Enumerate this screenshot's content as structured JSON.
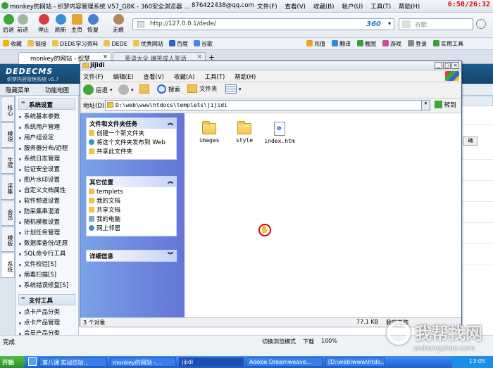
{
  "browser": {
    "window_title": "monkey的网站 - 织梦内容管理系统 V57_GBK - 360安全浏览器 ...",
    "account": "876422438@qq.com",
    "menus": [
      "文件(F)",
      "查看(V)",
      "收藏(B)",
      "帐户(U)",
      "工具(T)",
      "帮助(H)"
    ],
    "clock": "6:50/26:32",
    "nav": {
      "back": "后退",
      "forward": "前进",
      "stop": "停止",
      "refresh": "刷新",
      "home": "主页",
      "restore": "恢复",
      "no_image": "无痕"
    },
    "address": "http://127.0.0.1/dede/",
    "engine_badge": "360",
    "search_placeholder": "谷歌",
    "favorites": [
      "收藏",
      "链接",
      "DEDE学习资料",
      "DEDE",
      "优秀网站",
      "百度",
      "谷歌"
    ],
    "fav_right": [
      "充值",
      "翻译",
      "截图",
      "游戏",
      "登录",
      "实用工具"
    ],
    "tabs": [
      {
        "label": "monkey的网站 - 织梦",
        "active": true
      },
      {
        "label": "英语大全 爆笑成人笑话",
        "active": false
      }
    ],
    "status_text": "完成",
    "status_right": [
      "切换浏览模式",
      "下载",
      "100%"
    ]
  },
  "dede": {
    "brand": "DEDECMS",
    "brand_sub": "织梦内容管理系统 v5.7",
    "subnav": [
      "隐藏菜单",
      "功能地图"
    ],
    "vertical_tabs": [
      "核心",
      "模块",
      "生成",
      "采集",
      "会员",
      "模板",
      "系统"
    ],
    "sections": [
      {
        "title": "系统设置",
        "items": [
          "系统基本参数",
          "系统用户管理",
          "用户组设定",
          "服务器分布/远程",
          "系统日志管理",
          "验证安全设置",
          "图片水印设置",
          "自定义文档属性",
          "软件频道设置",
          "防采集串混淆",
          "随机模板设置",
          "计划任务管理",
          "数据库备份/还原",
          "SQL命令行工具",
          "文件校验[S]",
          "病毒扫描[S]",
          "系统错误修复[S]"
        ]
      },
      {
        "title": "支付工具",
        "items": [
          "点卡产品分类",
          "点卡产品管理",
          "会员产品分类"
        ]
      }
    ],
    "right_btn": "确"
  },
  "explorer": {
    "title": "jijidi",
    "menu": [
      "文件(F)",
      "编辑(E)",
      "查看(V)",
      "收藏(A)",
      "工具(T)",
      "帮助(H)"
    ],
    "toolbar": {
      "back": "后退",
      "search": "搜索",
      "folders": "文件夹"
    },
    "address_label": "地址(D)",
    "address_value": "D:\\web\\www\\htdocs\\templets\\jijidi",
    "go_label": "转到",
    "panels": {
      "tasks": {
        "title": "文件和文件夹任务",
        "items": [
          "创建一个新文件夹",
          "将这个文件夹发布到 Web",
          "共享此文件夹"
        ]
      },
      "other": {
        "title": "其它位置",
        "items": [
          "templets",
          "我的文档",
          "共享文档",
          "我的电脑",
          "网上邻居"
        ]
      },
      "details": {
        "title": "详细信息"
      }
    },
    "files": [
      {
        "name": "images",
        "kind": "folder"
      },
      {
        "name": "style",
        "kind": "folder"
      },
      {
        "name": "index.htm",
        "kind": "htm"
      }
    ],
    "status_left": "3 个对象",
    "status_size": "77.1 KB",
    "status_loc": "我的电脑"
  },
  "taskbar": {
    "start": "开始",
    "tasks": [
      "第八课 实战仿站...",
      "monkey的网站 -...",
      "jijidi",
      "Adobe Dreamweave...",
      "[D:\\web\\www\\htdo..."
    ],
    "time": "13:05"
  },
  "watermark": {
    "text": "我帮找网",
    "url": "wobangzhao.com"
  },
  "colors": {
    "dede_header": "#1d5c8b",
    "taskbar": "#1f5fd3",
    "explorer_tasks": "#6f8de0",
    "accent_red": "#e00000"
  }
}
